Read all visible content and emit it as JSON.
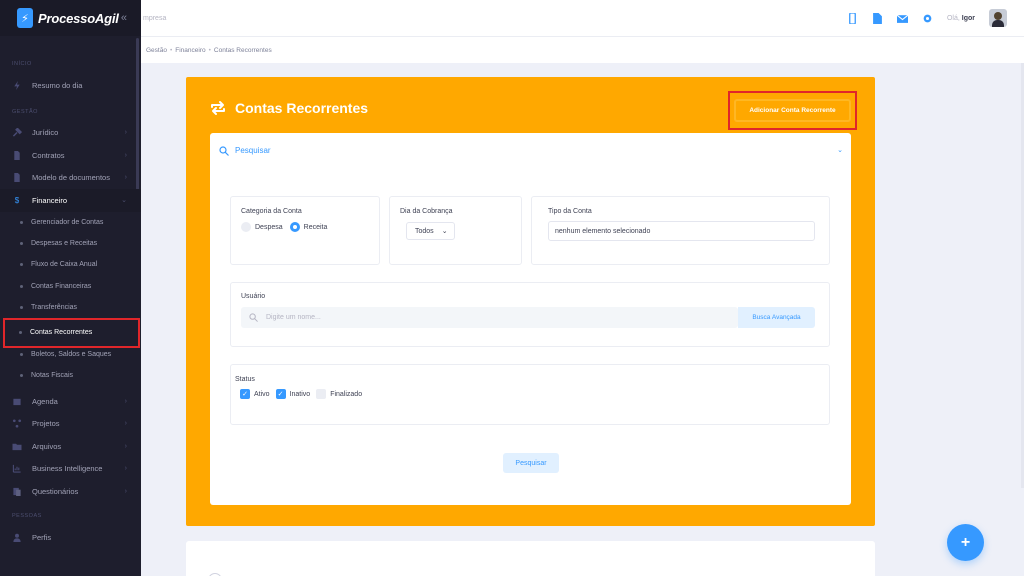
{
  "brand": {
    "name": "ProcessoAgil",
    "logo_glyph": "⚡",
    "collapse_glyph": "«"
  },
  "header": {
    "company": "mpresa",
    "greeting": "Olá,",
    "user": "Igor"
  },
  "breadcrumb": [
    "Gestão",
    "Financeiro",
    "Contas Recorrentes"
  ],
  "breadcrumb_sep": "•",
  "sidebar": {
    "section_inicio": "INÍCIO",
    "resumo": "Resumo do dia",
    "section_gestao": "GESTÃO",
    "juridico": "Jurídico",
    "contratos": "Contratos",
    "modelo": "Modelo de documentos",
    "financeiro": "Financeiro",
    "sub": [
      "Gerenciador de Contas",
      "Despesas e Receitas",
      "Fluxo de Caixa Anual",
      "Contas Financeiras",
      "Transferências",
      "Contas Recorrentes",
      "Boletos, Saldos e Saques",
      "Notas Fiscais"
    ],
    "agenda": "Agenda",
    "projetos": "Projetos",
    "arquivos": "Arquivos",
    "bi": "Business Intelligence",
    "questionarios": "Questionários",
    "section_pessoas": "PESSOAS",
    "perfis": "Perfis",
    "arrow": "›"
  },
  "card": {
    "title": "Contas Recorrentes",
    "add_button": "Adicionar Conta Recorrente"
  },
  "filters": {
    "search_title": "Pesquisar",
    "chevron": "⌄",
    "categoria_label": "Categoria da Conta",
    "despesa": "Despesa",
    "receita": "Receita",
    "dia_label": "Dia da Cobrança",
    "dia_value": "Todos",
    "dia_arrow": "⌄",
    "tipo_label": "Tipo da Conta",
    "tipo_value": "nenhum elemento selecionado",
    "usuario_label": "Usuário",
    "usuario_placeholder": "Digite um nome...",
    "busca_avancada": "Busca Avançada",
    "status_label": "Status",
    "ativo": "Ativo",
    "inativo": "Inativo",
    "finalizado": "Finalizado",
    "check_glyph": "✓",
    "search_button": "Pesquisar"
  },
  "fab": "+",
  "colors": {
    "accent": "#3699ff",
    "card": "#ffa800",
    "sidebar": "#1e1e2d",
    "highlight": "#e0262a"
  }
}
